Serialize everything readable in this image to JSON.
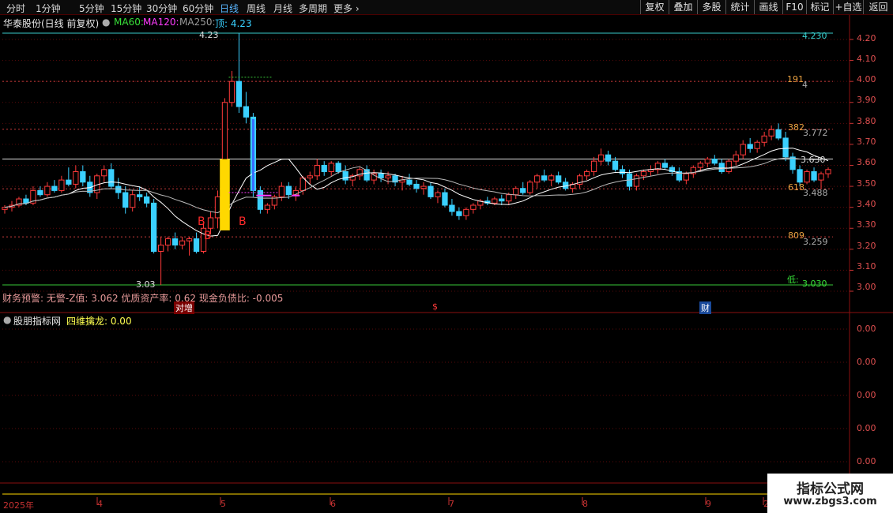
{
  "toolbar": {
    "periods": [
      "分时",
      "1分钟",
      "5分钟",
      "15分钟",
      "30分钟",
      "60分钟",
      "日线",
      "周线",
      "月线",
      "多周期",
      "更多"
    ],
    "active_period": "日线",
    "right_buttons": [
      "复权",
      "叠加",
      "多股",
      "统计",
      "画线",
      "F10",
      "标记",
      "+自选",
      "返回"
    ]
  },
  "main_title": {
    "stock": "华泰股份(日线 前复权)",
    "ma60": "MA60:",
    "ma120": "MA120:",
    "ma250": "MA250:",
    "top": "顶: 4.23"
  },
  "price_axis": [
    "4.20",
    "4.10",
    "4.00",
    "3.90",
    "3.80",
    "3.70",
    "3.60",
    "3.50",
    "3.40",
    "3.30",
    "3.20",
    "3.10",
    "3.00"
  ],
  "annotations": {
    "high": "4.23",
    "low": "3.03",
    "fib_191": "191",
    "fib_191_val": "4",
    "fib_382": "382",
    "fib_382_val": "3.772",
    "fib_618": "618",
    "fib_618_val": "3.488",
    "fib_809": "809",
    "fib_809_val": "3.259",
    "top_right_val": "4.230",
    "low_label": "低:",
    "low_right_val": "3.030",
    "current_val": "3.630",
    "b_marks": [
      "B",
      "B",
      "B"
    ]
  },
  "finance_line": "财务预警: 无警-Z值: 3.062 优质资产率: 0.62 现金负债比: -0.005",
  "event_tags": [
    "对增",
    "$",
    "财"
  ],
  "sub_panel": {
    "title": "股朋指标网",
    "indicator": "四维擒龙: 0.00",
    "axis": [
      "0.00",
      "0.00",
      "0.00",
      "0.00",
      "0.00"
    ]
  },
  "time_axis": [
    "2025年",
    "4",
    "5",
    "6",
    "7",
    "8",
    "9",
    "2"
  ],
  "watermark": {
    "line1": "指标公式网",
    "line2": "www.zbgs3.com"
  },
  "colors": {
    "up": "#ff3a3a",
    "down": "#3ad0ff",
    "ma": "#ffffff",
    "signal": "#ffd800",
    "buy": "#ff2a2a"
  },
  "chart_data": {
    "type": "candlestick",
    "ylim": [
      3.0,
      4.25
    ],
    "candles": [
      [
        3.39,
        3.41,
        3.37,
        3.4
      ],
      [
        3.4,
        3.43,
        3.38,
        3.41
      ],
      [
        3.41,
        3.45,
        3.4,
        3.44
      ],
      [
        3.44,
        3.46,
        3.41,
        3.42
      ],
      [
        3.42,
        3.5,
        3.41,
        3.48
      ],
      [
        3.48,
        3.5,
        3.45,
        3.46
      ],
      [
        3.46,
        3.52,
        3.45,
        3.5
      ],
      [
        3.5,
        3.53,
        3.47,
        3.48
      ],
      [
        3.48,
        3.55,
        3.47,
        3.53
      ],
      [
        3.53,
        3.59,
        3.5,
        3.51
      ],
      [
        3.51,
        3.6,
        3.49,
        3.57
      ],
      [
        3.57,
        3.6,
        3.5,
        3.52
      ],
      [
        3.52,
        3.55,
        3.45,
        3.47
      ],
      [
        3.47,
        3.56,
        3.44,
        3.55
      ],
      [
        3.55,
        3.6,
        3.52,
        3.58
      ],
      [
        3.58,
        3.61,
        3.49,
        3.5
      ],
      [
        3.5,
        3.54,
        3.44,
        3.47
      ],
      [
        3.47,
        3.5,
        3.37,
        3.4
      ],
      [
        3.4,
        3.48,
        3.38,
        3.46
      ],
      [
        3.46,
        3.5,
        3.43,
        3.45
      ],
      [
        3.45,
        3.47,
        3.4,
        3.42
      ],
      [
        3.42,
        3.44,
        3.18,
        3.19
      ],
      [
        3.19,
        3.26,
        3.03,
        3.22
      ],
      [
        3.22,
        3.26,
        3.19,
        3.25
      ],
      [
        3.25,
        3.28,
        3.2,
        3.22
      ],
      [
        3.22,
        3.26,
        3.2,
        3.24
      ],
      [
        3.24,
        3.26,
        3.17,
        3.25
      ],
      [
        3.25,
        3.28,
        3.18,
        3.19
      ],
      [
        3.19,
        3.32,
        3.18,
        3.3
      ],
      [
        3.3,
        3.38,
        3.27,
        3.35
      ],
      [
        3.35,
        3.48,
        3.3,
        3.45
      ],
      [
        3.45,
        3.92,
        3.42,
        3.9
      ],
      [
        3.9,
        4.05,
        3.88,
        4.0
      ],
      [
        4.0,
        4.23,
        3.85,
        3.88
      ],
      [
        3.88,
        3.95,
        3.8,
        3.83
      ],
      [
        3.83,
        3.85,
        3.45,
        3.48
      ],
      [
        3.48,
        3.5,
        3.37,
        3.39
      ],
      [
        3.39,
        3.42,
        3.37,
        3.41
      ],
      [
        3.41,
        3.46,
        3.39,
        3.45
      ],
      [
        3.45,
        3.52,
        3.43,
        3.5
      ],
      [
        3.5,
        3.52,
        3.44,
        3.46
      ],
      [
        3.46,
        3.5,
        3.43,
        3.48
      ],
      [
        3.48,
        3.55,
        3.46,
        3.54
      ],
      [
        3.54,
        3.57,
        3.51,
        3.55
      ],
      [
        3.55,
        3.63,
        3.53,
        3.6
      ],
      [
        3.6,
        3.62,
        3.55,
        3.57
      ],
      [
        3.57,
        3.62,
        3.55,
        3.61
      ],
      [
        3.61,
        3.62,
        3.56,
        3.57
      ],
      [
        3.57,
        3.6,
        3.51,
        3.53
      ],
      [
        3.53,
        3.56,
        3.5,
        3.55
      ],
      [
        3.55,
        3.59,
        3.53,
        3.58
      ],
      [
        3.58,
        3.6,
        3.52,
        3.53
      ],
      [
        3.53,
        3.58,
        3.51,
        3.56
      ],
      [
        3.56,
        3.58,
        3.52,
        3.54
      ],
      [
        3.54,
        3.57,
        3.51,
        3.55
      ],
      [
        3.55,
        3.56,
        3.5,
        3.52
      ],
      [
        3.52,
        3.55,
        3.48,
        3.53
      ],
      [
        3.53,
        3.56,
        3.5,
        3.51
      ],
      [
        3.51,
        3.53,
        3.47,
        3.49
      ],
      [
        3.49,
        3.52,
        3.46,
        3.5
      ],
      [
        3.5,
        3.52,
        3.44,
        3.45
      ],
      [
        3.45,
        3.48,
        3.42,
        3.47
      ],
      [
        3.47,
        3.49,
        3.4,
        3.41
      ],
      [
        3.41,
        3.44,
        3.36,
        3.38
      ],
      [
        3.38,
        3.4,
        3.34,
        3.36
      ],
      [
        3.36,
        3.4,
        3.34,
        3.39
      ],
      [
        3.39,
        3.42,
        3.37,
        3.41
      ],
      [
        3.41,
        3.44,
        3.39,
        3.43
      ],
      [
        3.43,
        3.45,
        3.41,
        3.42
      ],
      [
        3.42,
        3.45,
        3.41,
        3.44
      ],
      [
        3.44,
        3.46,
        3.41,
        3.43
      ],
      [
        3.43,
        3.47,
        3.41,
        3.46
      ],
      [
        3.46,
        3.5,
        3.44,
        3.49
      ],
      [
        3.49,
        3.52,
        3.46,
        3.47
      ],
      [
        3.47,
        3.53,
        3.46,
        3.52
      ],
      [
        3.52,
        3.56,
        3.49,
        3.55
      ],
      [
        3.55,
        3.58,
        3.52,
        3.53
      ],
      [
        3.53,
        3.56,
        3.5,
        3.55
      ],
      [
        3.55,
        3.57,
        3.51,
        3.52
      ],
      [
        3.52,
        3.54,
        3.48,
        3.49
      ],
      [
        3.49,
        3.52,
        3.47,
        3.51
      ],
      [
        3.51,
        3.56,
        3.49,
        3.55
      ],
      [
        3.55,
        3.58,
        3.53,
        3.57
      ],
      [
        3.57,
        3.64,
        3.55,
        3.62
      ],
      [
        3.62,
        3.68,
        3.6,
        3.65
      ],
      [
        3.65,
        3.67,
        3.6,
        3.62
      ],
      [
        3.62,
        3.64,
        3.57,
        3.58
      ],
      [
        3.58,
        3.6,
        3.54,
        3.56
      ],
      [
        3.56,
        3.58,
        3.48,
        3.5
      ],
      [
        3.5,
        3.56,
        3.48,
        3.55
      ],
      [
        3.55,
        3.58,
        3.53,
        3.57
      ],
      [
        3.57,
        3.6,
        3.55,
        3.58
      ],
      [
        3.58,
        3.62,
        3.56,
        3.61
      ],
      [
        3.61,
        3.63,
        3.58,
        3.59
      ],
      [
        3.59,
        3.6,
        3.55,
        3.57
      ],
      [
        3.57,
        3.59,
        3.52,
        3.53
      ],
      [
        3.53,
        3.57,
        3.51,
        3.56
      ],
      [
        3.56,
        3.6,
        3.54,
        3.59
      ],
      [
        3.59,
        3.62,
        3.57,
        3.61
      ],
      [
        3.61,
        3.64,
        3.59,
        3.63
      ],
      [
        3.63,
        3.65,
        3.6,
        3.61
      ],
      [
        3.61,
        3.63,
        3.56,
        3.57
      ],
      [
        3.57,
        3.63,
        3.56,
        3.62
      ],
      [
        3.62,
        3.67,
        3.6,
        3.65
      ],
      [
        3.65,
        3.72,
        3.63,
        3.7
      ],
      [
        3.7,
        3.73,
        3.66,
        3.68
      ],
      [
        3.68,
        3.72,
        3.66,
        3.71
      ],
      [
        3.71,
        3.76,
        3.69,
        3.74
      ],
      [
        3.74,
        3.79,
        3.72,
        3.77
      ],
      [
        3.77,
        3.8,
        3.72,
        3.73
      ],
      [
        3.73,
        3.76,
        3.62,
        3.64
      ],
      [
        3.64,
        3.66,
        3.56,
        3.58
      ],
      [
        3.58,
        3.6,
        3.5,
        3.52
      ],
      [
        3.52,
        3.58,
        3.51,
        3.57
      ],
      [
        3.57,
        3.59,
        3.52,
        3.53
      ],
      [
        3.53,
        3.57,
        3.49,
        3.56
      ],
      [
        3.56,
        3.59,
        3.54,
        3.58
      ]
    ],
    "series": [
      {
        "name": "MA60",
        "values": []
      },
      {
        "name": "MA120",
        "values": []
      },
      {
        "name": "MA250",
        "values": []
      }
    ],
    "hlines": [
      4.23,
      4.0,
      3.772,
      3.63,
      3.488,
      3.259,
      3.03
    ],
    "b_signals": [
      36,
      37,
      41
    ],
    "subpanel_values": [
      0
    ]
  }
}
